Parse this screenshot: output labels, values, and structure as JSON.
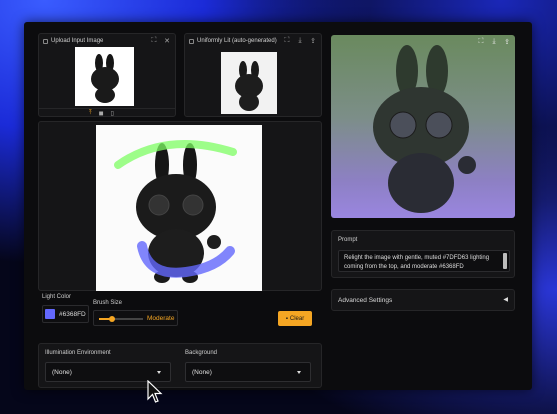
{
  "upload": {
    "label": "Upload Input Image"
  },
  "uniform": {
    "label": "Uniformly Lit (auto-generated)"
  },
  "light_color": {
    "label": "Light Color",
    "value": "#6368FD",
    "swatch": "#6368FD"
  },
  "brush": {
    "label": "Brush Size",
    "value": "Moderate",
    "level": 0.3
  },
  "clear_label": "Clear",
  "prompt": {
    "label": "Prompt",
    "text": "Relight the image with gentle, muted #7DFD63 lighting coming from the top, and moderate #6368FD"
  },
  "advanced": {
    "label": "Advanced Settings"
  },
  "illumination": {
    "label": "Illumination Environment",
    "value": "(None)"
  },
  "background": {
    "label": "Background",
    "value": "(None)"
  },
  "colors": {
    "accent": "#f5a623",
    "green_stroke": "#7DFD63",
    "blue_stroke": "#6368FD"
  }
}
